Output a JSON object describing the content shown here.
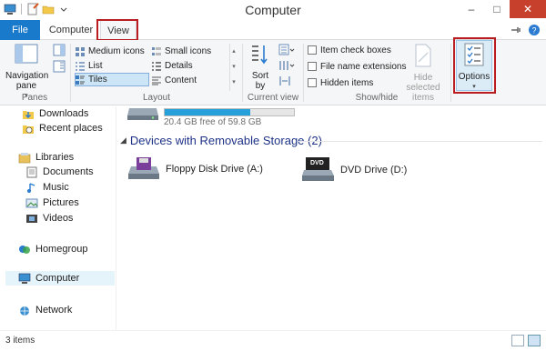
{
  "window": {
    "title": "Computer",
    "buttons": {
      "minimize": "–",
      "maximize": "□",
      "close": "✕"
    }
  },
  "ribbon_tabs": {
    "file": "File",
    "computer": "Computer",
    "view": "View"
  },
  "ribbon": {
    "panes": {
      "navigation_pane_line1": "Navigation",
      "navigation_pane_line2": "pane",
      "label": "Panes"
    },
    "layout": {
      "items": [
        "Medium icons",
        "Small icons",
        "List",
        "Details",
        "Tiles",
        "Content"
      ],
      "selected": "Tiles",
      "label": "Layout"
    },
    "current_view": {
      "sort_line1": "Sort",
      "sort_line2": "by",
      "label": "Current view"
    },
    "show_hide": {
      "item_check_boxes": "Item check boxes",
      "file_name_extensions": "File name extensions",
      "hidden_items": "Hidden items",
      "hide_selected_line1": "Hide selected",
      "hide_selected_line2": "items",
      "label": "Show/hide"
    },
    "options": {
      "label": "Options"
    }
  },
  "nav": {
    "items": [
      "Downloads",
      "Recent places",
      "Libraries",
      "Documents",
      "Music",
      "Pictures",
      "Videos",
      "Homegroup",
      "Computer",
      "Network"
    ],
    "selected": "Computer"
  },
  "main": {
    "drive_free": "20.4 GB free of 59.8 GB",
    "drive_used_fraction": 0.66,
    "section_title": "Devices with Removable Storage (2)",
    "devices": [
      "Floppy Disk Drive (A:)",
      "DVD Drive (D:)"
    ],
    "dvd_badge": "DVD"
  },
  "status": {
    "items": "3 items"
  },
  "colors": {
    "accent": "#1979ca",
    "highlight": "#b91d22",
    "section": "#1e3287",
    "drivebar": "#26a0da"
  }
}
